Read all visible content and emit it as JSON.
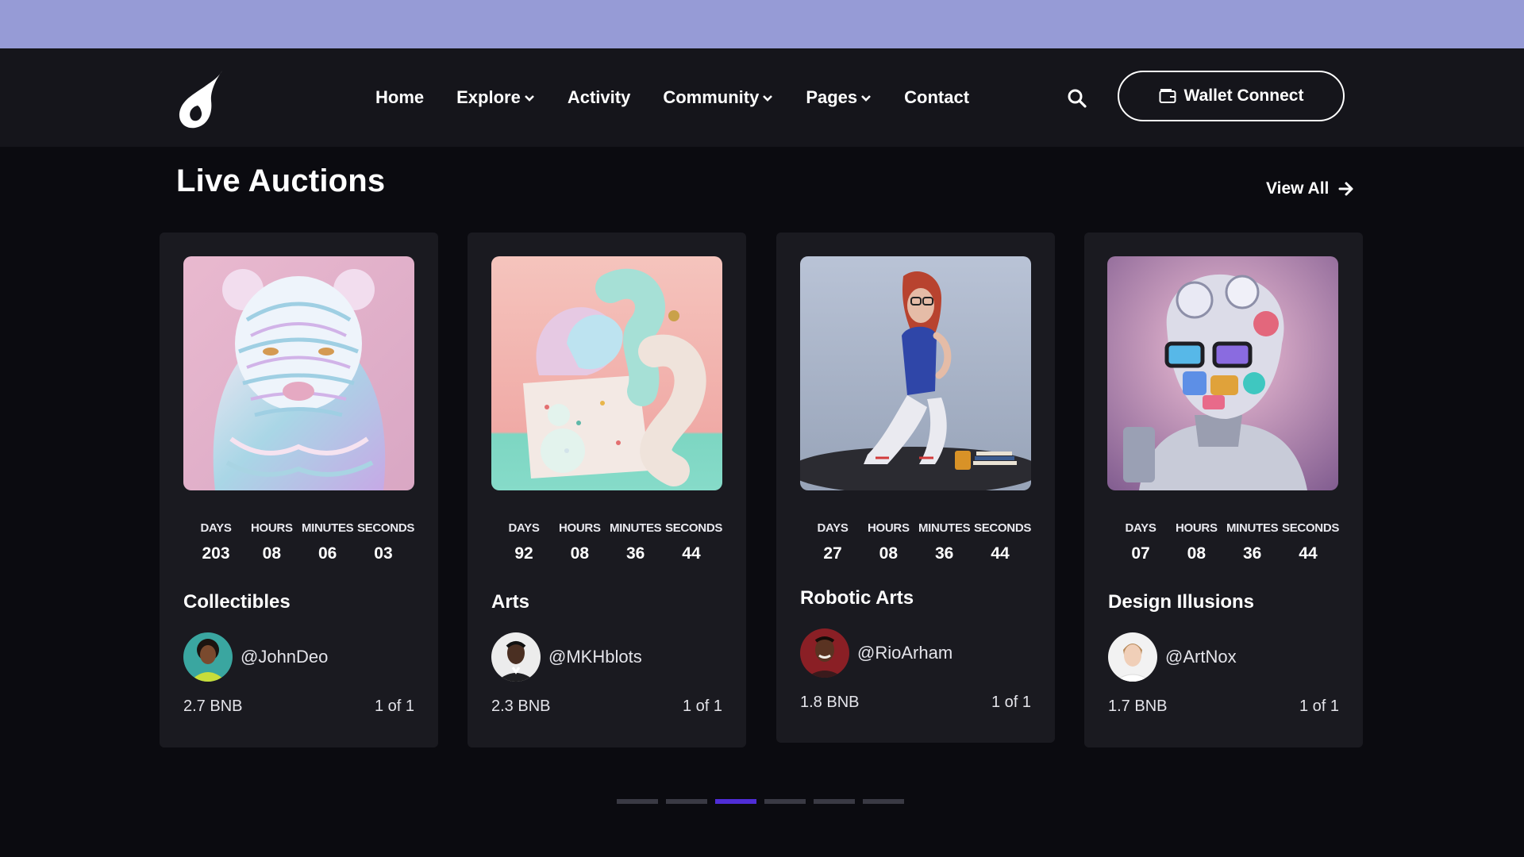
{
  "nav": {
    "items": [
      {
        "label": "Home",
        "has_dropdown": false
      },
      {
        "label": "Explore",
        "has_dropdown": true
      },
      {
        "label": "Activity",
        "has_dropdown": false
      },
      {
        "label": "Community",
        "has_dropdown": true
      },
      {
        "label": "Pages",
        "has_dropdown": true
      },
      {
        "label": "Contact",
        "has_dropdown": false
      }
    ],
    "wallet_label": "Wallet Connect"
  },
  "section": {
    "title": "Live Auctions",
    "view_all": "View All"
  },
  "timer_labels": {
    "days": "DAYS",
    "hours": "HOURS",
    "minutes": "MINUTES",
    "seconds": "SECONDS"
  },
  "cards": [
    {
      "title": "Collectibles",
      "owner": "@JohnDeo",
      "price": "2.7 BNB",
      "edition": "1 of 1",
      "days": "203",
      "hours": "08",
      "minutes": "06",
      "seconds": "03"
    },
    {
      "title": "Arts",
      "owner": "@MKHblots",
      "price": "2.3 BNB",
      "edition": "1 of 1",
      "days": "92",
      "hours": "08",
      "minutes": "36",
      "seconds": "44"
    },
    {
      "title": "Robotic Arts",
      "owner": "@RioArham",
      "price": "1.8 BNB",
      "edition": "1 of 1",
      "days": "27",
      "hours": "08",
      "minutes": "36",
      "seconds": "44"
    },
    {
      "title": "Design Illusions",
      "owner": "@ArtNox",
      "price": "1.7 BNB",
      "edition": "1 of 1",
      "days": "07",
      "hours": "08",
      "minutes": "36",
      "seconds": "44"
    }
  ],
  "pagination": {
    "total": 6,
    "active_index": 2
  },
  "colors": {
    "accent": "#4f2dd6",
    "top_band": "#969bd6",
    "navbar": "#15151b",
    "card": "#1a1a20"
  }
}
